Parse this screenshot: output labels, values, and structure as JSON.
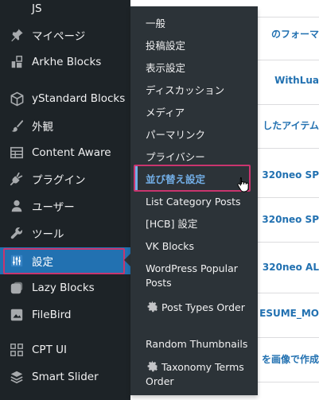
{
  "content": {
    "links": [
      "のフォーマ",
      "WithLua",
      "したアイテム",
      "320neo SP",
      "320neo SP",
      "320neo AL",
      "ESUME_MO",
      "を画像で作成"
    ]
  },
  "sidebar": {
    "items": [
      {
        "label": "JS",
        "icon": "none"
      },
      {
        "label": "マイページ",
        "icon": "pin-icon"
      },
      {
        "label": "Arkhe Blocks",
        "icon": "arkhe-icon"
      },
      {
        "label": "yStandard Blocks",
        "icon": "cube-icon"
      },
      {
        "label": "外観",
        "icon": "paintbrush-icon"
      },
      {
        "label": "Content Aware",
        "icon": "table-icon"
      },
      {
        "label": "プラグイン",
        "icon": "plugin-icon"
      },
      {
        "label": "ユーザー",
        "icon": "user-icon"
      },
      {
        "label": "ツール",
        "icon": "wrench-icon"
      },
      {
        "label": "設定",
        "icon": "settings-sliders-icon",
        "active": true
      },
      {
        "label": "Lazy Blocks",
        "icon": "block-icon"
      },
      {
        "label": "FileBird",
        "icon": "folder-icon"
      },
      {
        "label": "CPT UI",
        "icon": "grid-icon"
      },
      {
        "label": "Smart Slider",
        "icon": "slider-icon"
      }
    ]
  },
  "submenu": {
    "items": [
      {
        "label": "一般"
      },
      {
        "label": "投稿設定"
      },
      {
        "label": "表示設定"
      },
      {
        "label": "ディスカッション"
      },
      {
        "label": "メディア"
      },
      {
        "label": "パーマリンク"
      },
      {
        "label": "プライバシー"
      },
      {
        "label": "並び替え設定",
        "current": true
      },
      {
        "label": "List Category Posts"
      },
      {
        "label": "[HCB] 設定"
      },
      {
        "label": "VK Blocks"
      },
      {
        "label": "WordPress Popular Posts"
      },
      {
        "label": "Post Types Order",
        "icon": "gear-icon"
      },
      {
        "label": "Random Thumbnails"
      },
      {
        "label": "Taxonomy Terms Order",
        "icon": "gear-icon"
      }
    ]
  },
  "colors": {
    "sidebar_bg": "#1d2327",
    "submenu_bg": "#2c3338",
    "active_bg": "#2271b1",
    "current_text": "#72aee6",
    "highlight_outline": "#c9356e",
    "link": "#2271b1"
  }
}
